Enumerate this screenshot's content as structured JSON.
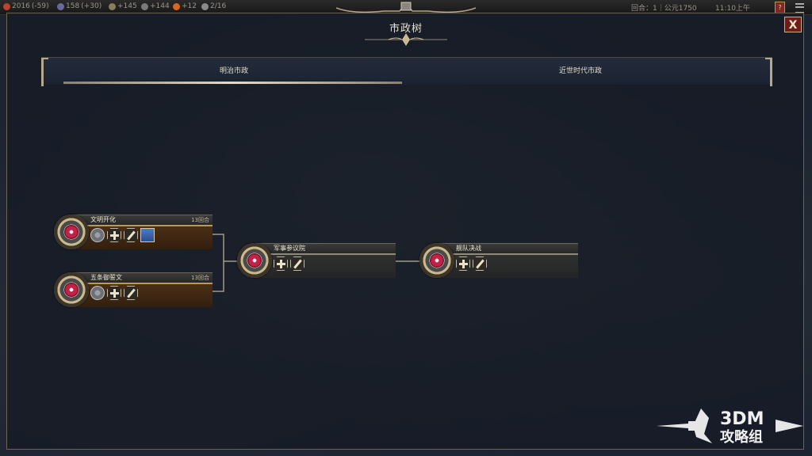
{
  "topbar": {
    "resources": [
      {
        "icon": "science-icon",
        "text": "2016",
        "delta": "(-59)",
        "color": "#b8432f"
      },
      {
        "icon": "culture-icon",
        "text": "158",
        "delta": "(+30)",
        "color": "#6a6a9a"
      },
      {
        "icon": "faith-icon",
        "text": "+145",
        "delta": "",
        "color": "#8a7c5a"
      },
      {
        "icon": "music-icon",
        "text": "+144",
        "delta": "",
        "color": "#7a7a7a"
      },
      {
        "icon": "happiness-icon",
        "text": "+12",
        "delta": "",
        "color": "#d8661e"
      },
      {
        "icon": "trade-icon",
        "text": "2/16",
        "delta": "",
        "color": "#8a8a8a"
      }
    ],
    "turn": "回合：1｜公元1750",
    "clock": "11:10上午",
    "help_label": "?"
  },
  "panel": {
    "title": "市政树",
    "close_label": "X",
    "tabs": [
      {
        "label": "明治市政",
        "active": true
      },
      {
        "label": "近世时代市政",
        "active": false
      }
    ]
  },
  "nodes": [
    {
      "name": "文明开化",
      "turns": "13回合",
      "state": "on",
      "icons": [
        "gear-icon",
        "plus-icon",
        "pen-icon",
        "card-icon"
      ]
    },
    {
      "name": "五条御誓文",
      "turns": "13回合",
      "state": "on",
      "icons": [
        "gear-icon",
        "plus-icon",
        "pen-icon"
      ]
    },
    {
      "name": "军事参议院",
      "turns": "",
      "state": "off",
      "icons": [
        "plus-icon",
        "pen-icon"
      ]
    },
    {
      "name": "舰队决战",
      "turns": "",
      "state": "off",
      "icons": [
        "plus-icon",
        "pen-icon"
      ]
    }
  ],
  "watermark": {
    "line1": "3DM",
    "line2": "攻略组"
  },
  "colors": {
    "accent_gold": "#b89a5c",
    "close_red": "#6e1c18",
    "panel_border": "#6d6353"
  }
}
